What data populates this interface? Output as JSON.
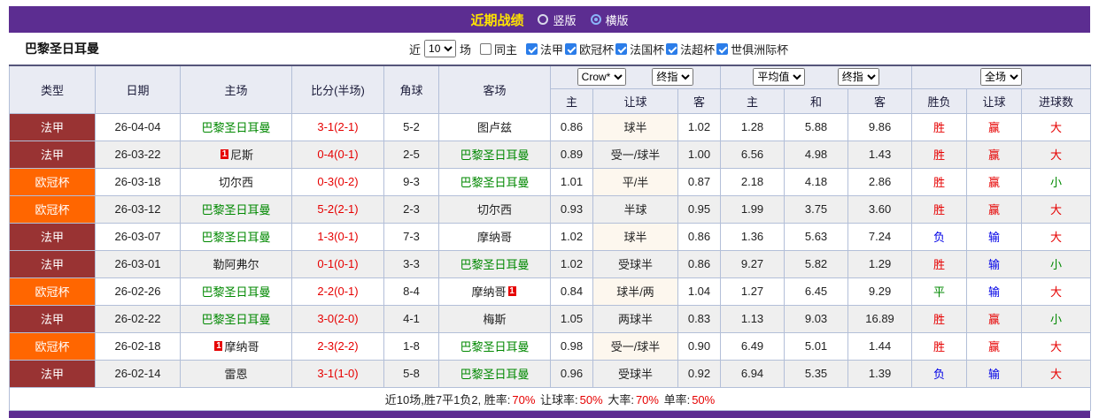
{
  "colors": {
    "purple": "#5c2d91",
    "yellow": "#ffe400",
    "ligue1": "#993333",
    "ucl": "#ff6600",
    "green": "#008800",
    "red": "#e60000",
    "blue": "#0000e6"
  },
  "title_bar": {
    "title": "近期战绩",
    "vertical_label": "竖版",
    "horizontal_label": "横版",
    "selected": "横版"
  },
  "filter_bar": {
    "team": "巴黎圣日耳曼",
    "near_label": "近",
    "near_value": "10",
    "matches_label": "场",
    "same_home_label": "同主",
    "same_home_checked": false,
    "leagues": [
      {
        "label": "法甲",
        "checked": true
      },
      {
        "label": "欧冠杯",
        "checked": true
      },
      {
        "label": "法国杯",
        "checked": true
      },
      {
        "label": "法超杯",
        "checked": true
      },
      {
        "label": "世俱洲际杯",
        "checked": true
      }
    ]
  },
  "table": {
    "selects": {
      "company": "Crow*",
      "final1": "终指",
      "average": "平均值",
      "final2": "终指",
      "scope": "全场"
    },
    "headers": {
      "type": "类型",
      "date": "日期",
      "home": "主场",
      "score": "比分(半场)",
      "corner": "角球",
      "away": "客场",
      "sub": [
        "主",
        "让球",
        "客",
        "主",
        "和",
        "客",
        "胜负",
        "让球",
        "进球数"
      ]
    },
    "rows": [
      {
        "league": "法甲",
        "league_cls": "fa",
        "date": "26-04-04",
        "home": {
          "name": "巴黎圣日耳曼",
          "green": true,
          "badge": null
        },
        "score": "3-1(2-1)",
        "corner": "5-2",
        "away": {
          "name": "图卢兹",
          "green": false,
          "badge": null
        },
        "odds": [
          "0.86",
          "球半",
          "1.02"
        ],
        "avg": [
          "1.28",
          "5.88",
          "9.86"
        ],
        "result": {
          "text": "胜",
          "cls": "c-red"
        },
        "hcp_result": {
          "text": "赢",
          "cls": "c-red"
        },
        "size": {
          "text": "大",
          "cls": "c-red"
        }
      },
      {
        "league": "法甲",
        "league_cls": "fa",
        "date": "26-03-22",
        "home": {
          "name": "尼斯",
          "green": false,
          "badge": {
            "pos": "before",
            "text": "1"
          }
        },
        "score": "0-4(0-1)",
        "corner": "2-5",
        "away": {
          "name": "巴黎圣日耳曼",
          "green": true,
          "badge": null
        },
        "odds": [
          "0.89",
          "受一/球半",
          "1.00"
        ],
        "avg": [
          "6.56",
          "4.98",
          "1.43"
        ],
        "result": {
          "text": "胜",
          "cls": "c-red"
        },
        "hcp_result": {
          "text": "赢",
          "cls": "c-red"
        },
        "size": {
          "text": "大",
          "cls": "c-red"
        }
      },
      {
        "league": "欧冠杯",
        "league_cls": "ucl",
        "date": "26-03-18",
        "home": {
          "name": "切尔西",
          "green": false,
          "badge": null
        },
        "score": "0-3(0-2)",
        "corner": "9-3",
        "away": {
          "name": "巴黎圣日耳曼",
          "green": true,
          "badge": null
        },
        "odds": [
          "1.01",
          "平/半",
          "0.87"
        ],
        "avg": [
          "2.18",
          "4.18",
          "2.86"
        ],
        "result": {
          "text": "胜",
          "cls": "c-red"
        },
        "hcp_result": {
          "text": "赢",
          "cls": "c-red"
        },
        "size": {
          "text": "小",
          "cls": "c-green"
        }
      },
      {
        "league": "欧冠杯",
        "league_cls": "ucl",
        "date": "26-03-12",
        "home": {
          "name": "巴黎圣日耳曼",
          "green": true,
          "badge": null
        },
        "score": "5-2(2-1)",
        "corner": "2-3",
        "away": {
          "name": "切尔西",
          "green": false,
          "badge": null
        },
        "odds": [
          "0.93",
          "半球",
          "0.95"
        ],
        "avg": [
          "1.99",
          "3.75",
          "3.60"
        ],
        "result": {
          "text": "胜",
          "cls": "c-red"
        },
        "hcp_result": {
          "text": "赢",
          "cls": "c-red"
        },
        "size": {
          "text": "大",
          "cls": "c-red"
        }
      },
      {
        "league": "法甲",
        "league_cls": "fa",
        "date": "26-03-07",
        "home": {
          "name": "巴黎圣日耳曼",
          "green": true,
          "badge": null
        },
        "score": "1-3(0-1)",
        "corner": "7-3",
        "away": {
          "name": "摩纳哥",
          "green": false,
          "badge": null
        },
        "odds": [
          "1.02",
          "球半",
          "0.86"
        ],
        "avg": [
          "1.36",
          "5.63",
          "7.24"
        ],
        "result": {
          "text": "负",
          "cls": "c-blue"
        },
        "hcp_result": {
          "text": "输",
          "cls": "c-blue"
        },
        "size": {
          "text": "大",
          "cls": "c-red"
        }
      },
      {
        "league": "法甲",
        "league_cls": "fa",
        "date": "26-03-01",
        "home": {
          "name": "勒阿弗尔",
          "green": false,
          "badge": null
        },
        "score": "0-1(0-1)",
        "corner": "3-3",
        "away": {
          "name": "巴黎圣日耳曼",
          "green": true,
          "badge": null
        },
        "odds": [
          "1.02",
          "受球半",
          "0.86"
        ],
        "avg": [
          "9.27",
          "5.82",
          "1.29"
        ],
        "result": {
          "text": "胜",
          "cls": "c-red"
        },
        "hcp_result": {
          "text": "输",
          "cls": "c-blue"
        },
        "size": {
          "text": "小",
          "cls": "c-green"
        }
      },
      {
        "league": "欧冠杯",
        "league_cls": "ucl",
        "date": "26-02-26",
        "home": {
          "name": "巴黎圣日耳曼",
          "green": true,
          "badge": null
        },
        "score": "2-2(0-1)",
        "corner": "8-4",
        "away": {
          "name": "摩纳哥",
          "green": false,
          "badge": {
            "pos": "after",
            "text": "1"
          }
        },
        "odds": [
          "0.84",
          "球半/两",
          "1.04"
        ],
        "avg": [
          "1.27",
          "6.45",
          "9.29"
        ],
        "result": {
          "text": "平",
          "cls": "c-green"
        },
        "hcp_result": {
          "text": "输",
          "cls": "c-blue"
        },
        "size": {
          "text": "大",
          "cls": "c-red"
        }
      },
      {
        "league": "法甲",
        "league_cls": "fa",
        "date": "26-02-22",
        "home": {
          "name": "巴黎圣日耳曼",
          "green": true,
          "badge": null
        },
        "score": "3-0(2-0)",
        "corner": "4-1",
        "away": {
          "name": "梅斯",
          "green": false,
          "badge": null
        },
        "odds": [
          "1.05",
          "两球半",
          "0.83"
        ],
        "avg": [
          "1.13",
          "9.03",
          "16.89"
        ],
        "result": {
          "text": "胜",
          "cls": "c-red"
        },
        "hcp_result": {
          "text": "赢",
          "cls": "c-red"
        },
        "size": {
          "text": "小",
          "cls": "c-green"
        }
      },
      {
        "league": "欧冠杯",
        "league_cls": "ucl",
        "date": "26-02-18",
        "home": {
          "name": "摩纳哥",
          "green": false,
          "badge": {
            "pos": "before",
            "text": "1"
          }
        },
        "score": "2-3(2-2)",
        "corner": "1-8",
        "away": {
          "name": "巴黎圣日耳曼",
          "green": true,
          "badge": null
        },
        "odds": [
          "0.98",
          "受一/球半",
          "0.90"
        ],
        "avg": [
          "6.49",
          "5.01",
          "1.44"
        ],
        "result": {
          "text": "胜",
          "cls": "c-red"
        },
        "hcp_result": {
          "text": "赢",
          "cls": "c-red"
        },
        "size": {
          "text": "大",
          "cls": "c-red"
        }
      },
      {
        "league": "法甲",
        "league_cls": "fa",
        "date": "26-02-14",
        "home": {
          "name": "雷恩",
          "green": false,
          "badge": null
        },
        "score": "3-1(1-0)",
        "corner": "5-8",
        "away": {
          "name": "巴黎圣日耳曼",
          "green": true,
          "badge": null
        },
        "odds": [
          "0.96",
          "受球半",
          "0.92"
        ],
        "avg": [
          "6.94",
          "5.35",
          "1.39"
        ],
        "result": {
          "text": "负",
          "cls": "c-blue"
        },
        "hcp_result": {
          "text": "输",
          "cls": "c-blue"
        },
        "size": {
          "text": "大",
          "cls": "c-red"
        }
      }
    ]
  },
  "footer": {
    "segments": [
      {
        "text": "近10场,胜7平1负2, 胜率:",
        "red": false
      },
      {
        "text": "70%",
        "red": true
      },
      {
        "text": " 让球率:",
        "red": false
      },
      {
        "text": "50%",
        "red": true
      },
      {
        "text": " 大率:",
        "red": false
      },
      {
        "text": "70%",
        "red": true
      },
      {
        "text": " 单率:",
        "red": false
      },
      {
        "text": "50%",
        "red": true
      }
    ]
  }
}
